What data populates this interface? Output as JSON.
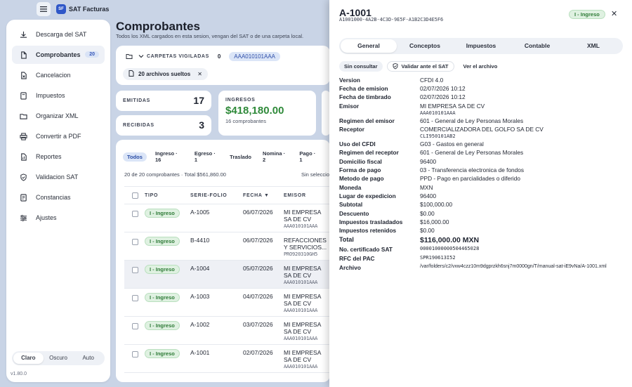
{
  "app": {
    "logo_text": "SF",
    "title": "SAT Facturas",
    "version": "v1.80.0"
  },
  "sidebar": {
    "items": [
      {
        "label": "Descarga del SAT",
        "icon": "download-icon"
      },
      {
        "label": "Comprobantes",
        "icon": "file-icon",
        "badge": "20",
        "active": true
      },
      {
        "label": "Cancelacion",
        "icon": "file-x-icon"
      },
      {
        "label": "Impuestos",
        "icon": "calculator-icon"
      },
      {
        "label": "Organizar XML",
        "icon": "folder-icon"
      },
      {
        "label": "Convertir a PDF",
        "icon": "printer-icon"
      },
      {
        "label": "Reportes",
        "icon": "chart-icon"
      },
      {
        "label": "Validacion SAT",
        "icon": "shield-check-icon"
      },
      {
        "label": "Constancias",
        "icon": "document-icon"
      },
      {
        "label": "Ajustes",
        "icon": "sliders-icon"
      }
    ],
    "theme": {
      "options": [
        "Claro",
        "Oscuro",
        "Auto"
      ],
      "selected": "Claro"
    }
  },
  "main": {
    "title": "Comprobantes",
    "subtitle": "Todos los XML cargados en esta sesion, vengan del SAT o de una carpeta local.",
    "folders": {
      "label": "CARPETAS VIGILADAS",
      "count": "0",
      "rfc": "AAA010101AAA",
      "loose": "20 archivos sueltos"
    },
    "stats": {
      "emitidas_label": "EMITIDAS",
      "emitidas": "17",
      "recibidas_label": "RECIBIDAS",
      "recibidas": "3",
      "ingresos_label": "INGRESOS",
      "ingresos": "$418,180.00",
      "ingresos_sub": "16 comprobantes"
    },
    "filters": [
      "Todos",
      "Ingreso · 16",
      "Egreso · 1",
      "Traslado",
      "Nomina · 2",
      "Pago · 1"
    ],
    "count_line": "20 de 20 comprobantes · Total $561,860.00",
    "selection": "Sin seleccion",
    "columns": {
      "tipo": "TIPO",
      "folio": "SERIE-FOLIO",
      "fecha": "FECHA ▼",
      "emisor": "EMISOR"
    },
    "rows": [
      {
        "tipo": "I - Ingreso",
        "folio": "A-1005",
        "fecha": "06/07/2026",
        "emisor": "MI EMPRESA SA DE CV",
        "rfc": "AAA010101AAA"
      },
      {
        "tipo": "I - Ingreso",
        "folio": "B-4410",
        "fecha": "06/07/2026",
        "emisor": "REFACCIONES Y SERVICIOS...",
        "rfc": "PRO920310GH5"
      },
      {
        "tipo": "I - Ingreso",
        "folio": "A-1004",
        "fecha": "05/07/2026",
        "emisor": "MI EMPRESA SA DE CV",
        "rfc": "AAA010101AAA"
      },
      {
        "tipo": "I - Ingreso",
        "folio": "A-1003",
        "fecha": "04/07/2026",
        "emisor": "MI EMPRESA SA DE CV",
        "rfc": "AAA010101AAA"
      },
      {
        "tipo": "I - Ingreso",
        "folio": "A-1002",
        "fecha": "03/07/2026",
        "emisor": "MI EMPRESA SA DE CV",
        "rfc": "AAA010101AAA"
      },
      {
        "tipo": "I - Ingreso",
        "folio": "A-1001",
        "fecha": "02/07/2026",
        "emisor": "MI EMPRESA SA DE CV",
        "rfc": "AAA010101AAA"
      }
    ]
  },
  "drawer": {
    "title": "A-1001",
    "uuid": "A1001000-4A2B-4C3D-9E5F-A1B2C3D4E5F6",
    "badge": "I - Ingreso",
    "tabs": [
      "General",
      "Conceptos",
      "Impuestos",
      "Contable",
      "XML"
    ],
    "active_tab": "General",
    "actions": {
      "consult": "Sin consultar",
      "validate": "Validar ante el SAT",
      "view": "Ver el archivo"
    },
    "fields": [
      {
        "k": "Version",
        "v": "CFDI 4.0"
      },
      {
        "k": "Fecha de emision",
        "v": "02/07/2026 10:12"
      },
      {
        "k": "Fecha de timbrado",
        "v": "02/07/2026 10:12"
      },
      {
        "k": "Emisor",
        "v": "MI EMPRESA SA DE CV",
        "sub": "AAA010101AAA"
      },
      {
        "k": "Regimen del emisor",
        "v": "601 - General de Ley Personas Morales"
      },
      {
        "k": "Receptor",
        "v": "COMERCIALIZADORA DEL GOLFO SA DE CV",
        "sub": "CLI950101AB2"
      },
      {
        "k": "Uso del CFDI",
        "v": "G03 - Gastos en general"
      },
      {
        "k": "Regimen del receptor",
        "v": "601 - General de Ley Personas Morales"
      },
      {
        "k": "Domicilio fiscal",
        "v": "96400"
      },
      {
        "k": "Forma de pago",
        "v": "03 - Transferencia electronica de fondos"
      },
      {
        "k": "Metodo de pago",
        "v": "PPD - Pago en parcialidades o diferido"
      },
      {
        "k": "Moneda",
        "v": "MXN"
      },
      {
        "k": "Lugar de expedicion",
        "v": "96400"
      },
      {
        "k": "Subtotal",
        "v": "$100,000.00"
      },
      {
        "k": "Descuento",
        "v": "$0.00"
      },
      {
        "k": "Impuestos trasladados",
        "v": "$16,000.00"
      },
      {
        "k": "Impuestos retenidos",
        "v": "$0.00"
      },
      {
        "k": "Total",
        "v": "$116,000.00 MXN"
      },
      {
        "k": "No. certificado SAT",
        "v": "00001000000504465028"
      },
      {
        "k": "RFC del PAC",
        "v": "SPR190613I52"
      },
      {
        "k": "Archivo",
        "v": "/var/folders/c2/vxw4czz10m9dgprzkh6snj7m0000gn/T/manual-sat-iE9vNa/A-1001.xml"
      }
    ]
  },
  "colors": {
    "accent": "#2f57c8",
    "money": "#2f8a3a",
    "ingreso_bg": "#dff1e1",
    "ingreso_fg": "#2d7a36"
  }
}
